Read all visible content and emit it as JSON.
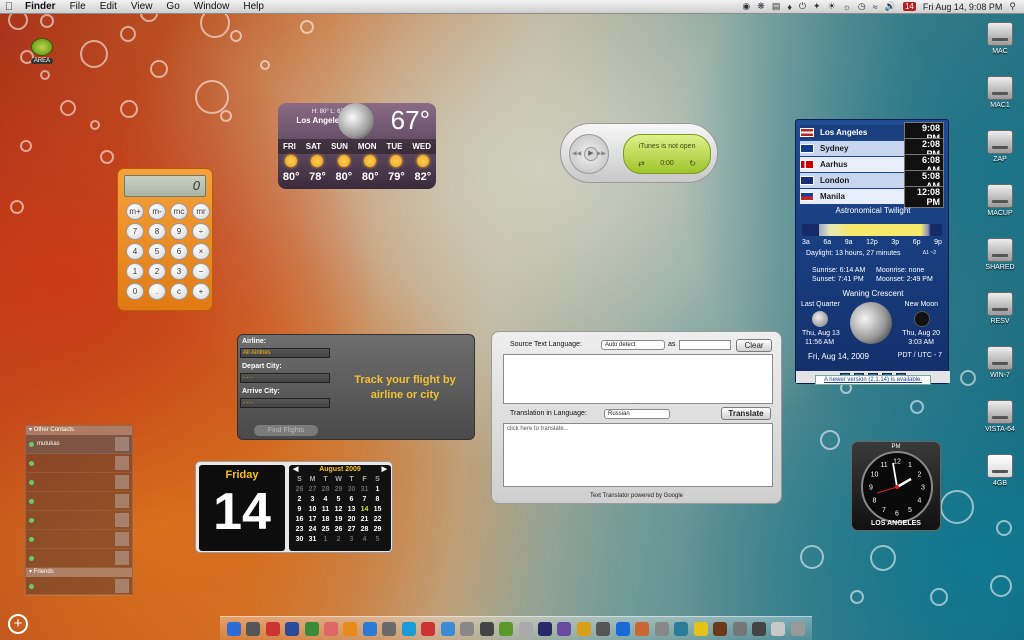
{
  "menubar": {
    "app": "Finder",
    "items": [
      "File",
      "Edit",
      "View",
      "Go",
      "Window",
      "Help"
    ],
    "date_badge": "14",
    "clock": "Fri Aug 14, 9:08 PM"
  },
  "desktop": {
    "area_label": "AREA",
    "drives": [
      "MAC",
      "MAC1",
      "ZAP",
      "MACUP",
      "SHARED",
      "RESV",
      "WIN-7",
      "VISTA-64",
      "4GB"
    ]
  },
  "calculator": {
    "display": "0",
    "keys": [
      "m+",
      "m-",
      "mc",
      "mr",
      "7",
      "8",
      "9",
      "÷",
      "4",
      "5",
      "6",
      "×",
      "1",
      "2",
      "3",
      "−",
      "0",
      ".",
      "c",
      "+",
      "="
    ]
  },
  "weather": {
    "hilo": "H: 80° L: 62°",
    "city": "Los Angeles",
    "temp": "67°",
    "days": [
      "FRI",
      "SAT",
      "SUN",
      "MON",
      "TUE",
      "WED"
    ],
    "temps": [
      "80°",
      "78°",
      "80°",
      "80°",
      "79°",
      "82°"
    ]
  },
  "itunes": {
    "message": "iTunes is not open",
    "time": "0:00"
  },
  "worldclock": {
    "cities": [
      {
        "name": "Los Angeles",
        "time": "9:08 PM"
      },
      {
        "name": "Sydney",
        "time": "2:08 PM"
      },
      {
        "name": "Aarhus",
        "time": "6:08 AM"
      },
      {
        "name": "London",
        "time": "5:08 AM"
      },
      {
        "name": "Manila",
        "time": "12:08 PM"
      }
    ],
    "twilight_title": "Astronomical Twilight",
    "hours": [
      "3a",
      "6a",
      "9a",
      "12p",
      "3p",
      "6p",
      "9p"
    ],
    "daylight": "Daylight: 13 hours, 27 minutes",
    "tz_offset": "Δ1 ~2",
    "sunrise": "Sunrise: 6:14 AM",
    "sunset": "Sunset: 7:41 PM",
    "moonrise": "Moonrise: none",
    "moonset": "Moonset: 2:49 PM",
    "phase": "Waning Crescent",
    "last_quarter": "Last Quarter",
    "lq_date": "Thu, Aug 13",
    "lq_time": "11:56 AM",
    "new_moon": "New Moon",
    "nm_date": "Thu, Aug 20",
    "nm_time": "3:03 AM",
    "date": "Fri, Aug 14, 2009",
    "tz": "PDT / UTC - 7",
    "new_version": "A newer version (2.1.14) is available."
  },
  "flight": {
    "airline_label": "Airline:",
    "airline_value": "All Airlines",
    "depart_label": "Depart City:",
    "depart_value": "- - -",
    "arrive_label": "Arrive City:",
    "arrive_value": "- - -",
    "message": "Track your flight by airline or city",
    "find_label": "Find Flights"
  },
  "translator": {
    "source_label": "Source Text Language:",
    "source_value": "Auto detect",
    "as_label": "as",
    "clear_label": "Clear",
    "target_label": "Translation in Language:",
    "target_value": "Russian",
    "translate_label": "Translate",
    "result_placeholder": "click here to translate...",
    "footer": "Text Translator powered by Google"
  },
  "calendar": {
    "day_name": "Friday",
    "day_num": "14",
    "month": "August 2009",
    "headers": [
      "S",
      "M",
      "T",
      "W",
      "T",
      "F",
      "S"
    ],
    "days": [
      [
        "26",
        "d"
      ],
      [
        "27",
        "d"
      ],
      [
        "28",
        "d"
      ],
      [
        "29",
        "d"
      ],
      [
        "30",
        "d"
      ],
      [
        "31",
        "d"
      ],
      [
        "1",
        ""
      ],
      [
        "2",
        ""
      ],
      [
        "3",
        ""
      ],
      [
        "4",
        ""
      ],
      [
        "5",
        ""
      ],
      [
        "6",
        ""
      ],
      [
        "7",
        ""
      ],
      [
        "8",
        ""
      ],
      [
        "9",
        ""
      ],
      [
        "10",
        ""
      ],
      [
        "11",
        ""
      ],
      [
        "12",
        ""
      ],
      [
        "13",
        ""
      ],
      [
        "14",
        "t"
      ],
      [
        "15",
        ""
      ],
      [
        "16",
        ""
      ],
      [
        "17",
        ""
      ],
      [
        "18",
        ""
      ],
      [
        "19",
        ""
      ],
      [
        "20",
        ""
      ],
      [
        "21",
        ""
      ],
      [
        "22",
        ""
      ],
      [
        "23",
        ""
      ],
      [
        "24",
        ""
      ],
      [
        "25",
        ""
      ],
      [
        "26",
        ""
      ],
      [
        "27",
        ""
      ],
      [
        "28",
        ""
      ],
      [
        "29",
        ""
      ],
      [
        "30",
        ""
      ],
      [
        "31",
        ""
      ],
      [
        "1",
        "d"
      ],
      [
        "2",
        "d"
      ],
      [
        "3",
        "d"
      ],
      [
        "4",
        "d"
      ],
      [
        "5",
        "d"
      ]
    ]
  },
  "analogclock": {
    "ampm": "PM",
    "city": "LOS ANGELES",
    "numbers": [
      "12",
      "1",
      "2",
      "3",
      "4",
      "5",
      "6",
      "7",
      "8",
      "9",
      "10",
      "11"
    ]
  },
  "ichat": {
    "other_header": "Other Contacts",
    "friends_header": "Friends",
    "first_contact": "mutukas"
  },
  "colors": {
    "accent_orange": "#e07a12",
    "clock_blue": "#1f4c94",
    "lcd_green": "#b3d844"
  }
}
